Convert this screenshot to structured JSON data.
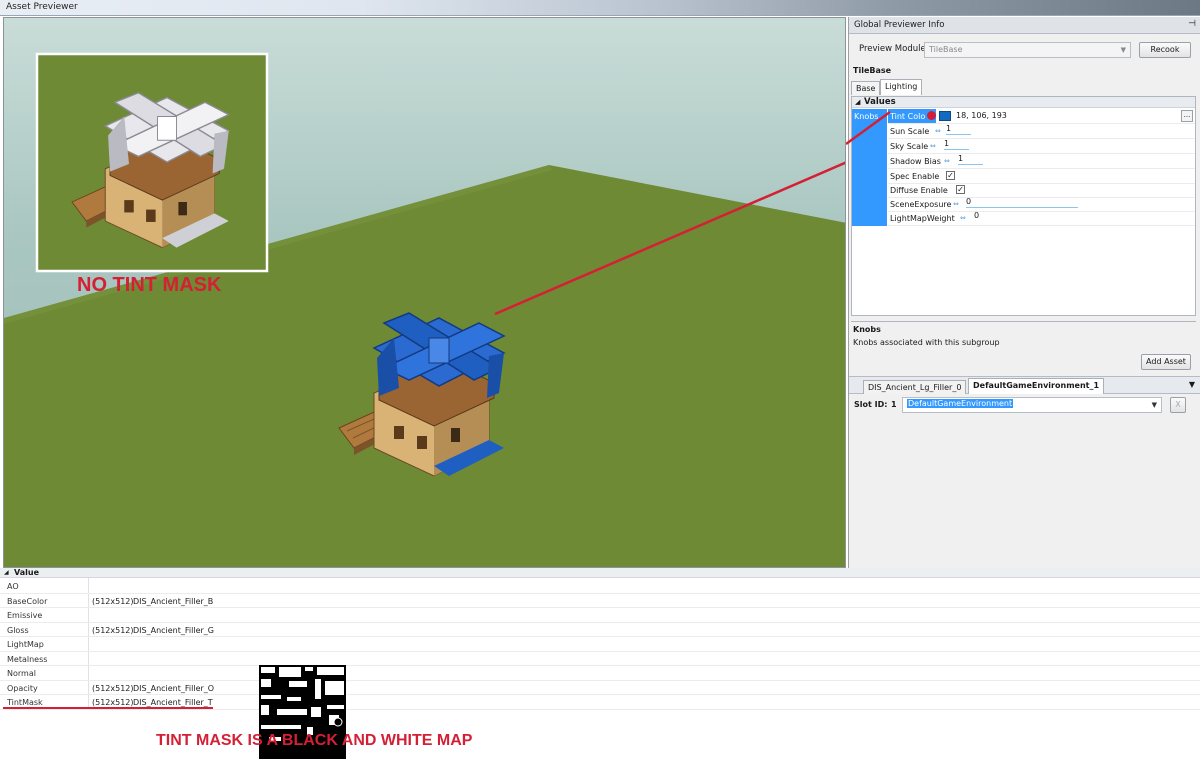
{
  "window": {
    "title": "Asset Previewer"
  },
  "annotations": {
    "no_tint_mask": "NO TINT MASK",
    "tint_mask_note": "TINT MASK IS A BLACK AND WHITE MAP"
  },
  "panel": {
    "title": "Global Previewer Info",
    "preview_modules_label": "Preview Modules",
    "preview_modules_value": "TileBase",
    "recook_label": "Recook",
    "group_label": "TileBase",
    "tabs": [
      "Base",
      "Lighting"
    ],
    "active_tab": "Lighting",
    "values_header": "Values",
    "category": "Knobs",
    "properties": [
      {
        "name": "Tint Color",
        "value": "18, 106, 193"
      },
      {
        "name": "Sun Scale",
        "value": "1"
      },
      {
        "name": "Sky Scale",
        "value": "1"
      },
      {
        "name": "Shadow Bias",
        "value": "1"
      },
      {
        "name": "Spec Enable",
        "value": "✓"
      },
      {
        "name": "Diffuse Enable",
        "value": "✓"
      },
      {
        "name": "SceneExposure",
        "value": "0"
      },
      {
        "name": "LightMapWeight",
        "value": "0"
      }
    ],
    "tint_swatch_color": "#126AC1",
    "tint_name_short": "Tint Colo",
    "ellipsis": "...",
    "description_title": "Knobs",
    "description_text": "Knobs associated with this subgroup",
    "add_asset_label": "Add Asset",
    "env_tabs": [
      "DIS_Ancient_Lg_Filler_0",
      "DefaultGameEnvironment_1"
    ],
    "active_env_tab": "DefaultGameEnvironment_1",
    "slot_id_label": "Slot ID:",
    "slot_id_value": "1",
    "slot_combo_value": "DefaultGameEnvironment",
    "slot_clear": "X"
  },
  "bottom_grid": {
    "header": "Value",
    "rows": [
      {
        "name": "AO",
        "size": "",
        "file": ""
      },
      {
        "name": "BaseColor",
        "size": "(512x512)",
        "file": "DIS_Ancient_Filler_B"
      },
      {
        "name": "Emissive",
        "size": "",
        "file": ""
      },
      {
        "name": "Gloss",
        "size": "(512x512)",
        "file": "DIS_Ancient_Filler_G"
      },
      {
        "name": "LightMap",
        "size": "",
        "file": ""
      },
      {
        "name": "Metalness",
        "size": "",
        "file": ""
      },
      {
        "name": "Normal",
        "size": "",
        "file": ""
      },
      {
        "name": "Opacity",
        "size": "(512x512)",
        "file": "DIS_Ancient_Filler_O"
      },
      {
        "name": "TintMask",
        "size": "(512x512)",
        "file": "DIS_Ancient_Filler_T"
      }
    ]
  },
  "colors": {
    "accent_red": "#d42035",
    "selection_blue": "#3399ff",
    "ground_green": "#6f8a35",
    "roof_blue": "#1f5fc2",
    "roof_white": "#e8e8ec"
  }
}
